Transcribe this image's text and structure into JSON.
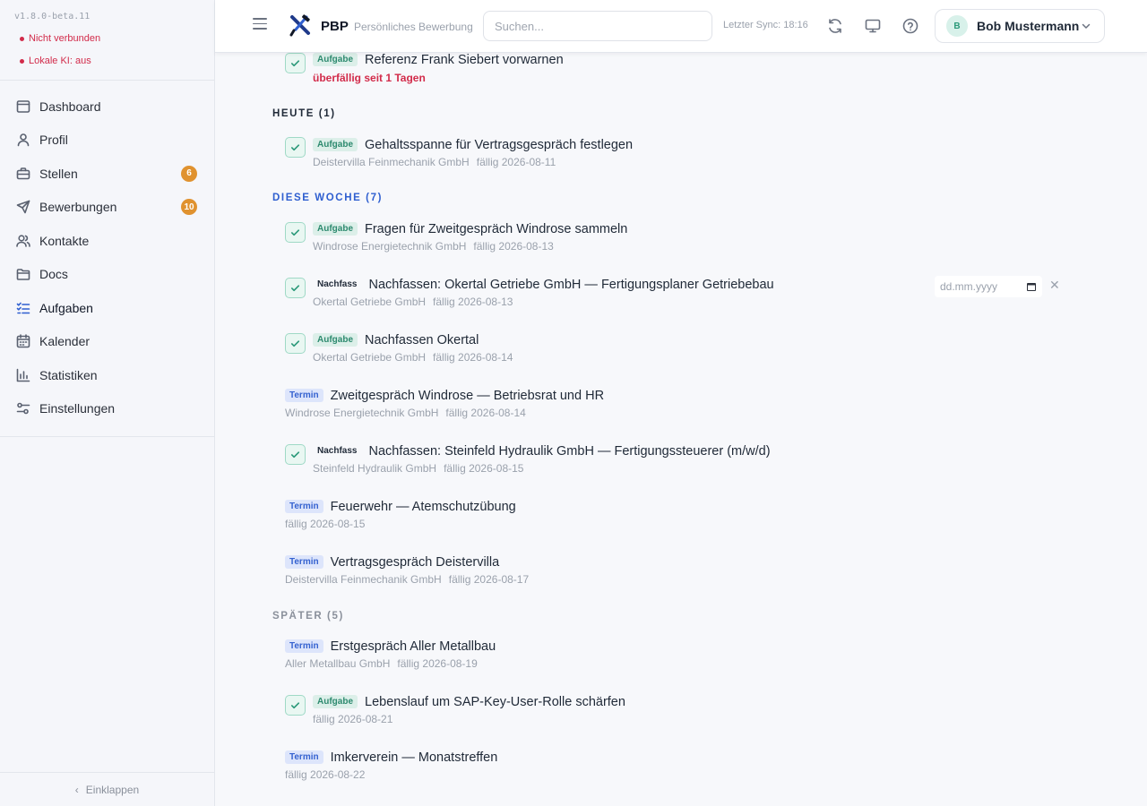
{
  "app": {
    "version": "v1.8.0-beta.11",
    "status": [
      "Nicht verbunden",
      "Lokale KI: aus"
    ],
    "brand": "PBP",
    "brand_subtitle": "Persönliches Bewerbungsportal",
    "search_placeholder": "Suchen...",
    "sync": "Letzter Sync: 18:16",
    "user_initial": "B",
    "user_name": "Bob Mustermann",
    "accent": "#2f5fd0"
  },
  "sidebar": {
    "items": [
      {
        "label": "Dashboard",
        "icon": "dashboard-icon"
      },
      {
        "label": "Profil",
        "icon": "user-icon"
      },
      {
        "label": "Stellen",
        "icon": "briefcase-icon",
        "badge": "6"
      },
      {
        "label": "Bewerbungen",
        "icon": "send-icon",
        "badge": "10"
      },
      {
        "label": "Kontakte",
        "icon": "contacts-icon"
      },
      {
        "label": "Docs",
        "icon": "folder-icon"
      },
      {
        "label": "Aufgaben",
        "icon": "checklist-icon",
        "active": true
      },
      {
        "label": "Kalender",
        "icon": "calendar-icon"
      },
      {
        "label": "Statistiken",
        "icon": "chart-icon"
      },
      {
        "label": "Einstellungen",
        "icon": "settings-icon"
      }
    ],
    "collapse_label": "Einklappen"
  },
  "tasks": {
    "overdue_item": {
      "badge": "Aufgabe",
      "title": "Referenz Frank Siebert vorwarnen",
      "note": "überfällig seit 1 Tagen"
    },
    "sections": [
      {
        "label": "HEUTE (1)",
        "color": "#1f2937"
      },
      {
        "label": "DIESE WOCHE (7)",
        "color": "#2f5fd0"
      },
      {
        "label": "SPÄTER (5)",
        "color": "#8a909b"
      }
    ],
    "items": [
      {
        "badge": "Aufgabe",
        "title": "Gehaltsspanne für Vertragsgespräch festlegen",
        "company": "Deistervilla Feinmechanik GmbH",
        "due": "fällig 2026-08-11"
      },
      {
        "badge": "Aufgabe",
        "title": "Fragen für Zweitgespräch Windrose sammeln",
        "company": "Windrose Energietechnik GmbH",
        "due": "fällig 2026-08-13"
      },
      {
        "badge": "Nachfass",
        "title": "Nachfassen: Okertal Getriebe GmbH — Fertigungsplaner Getriebebau",
        "company": "Okertal Getriebe GmbH",
        "due": "fällig 2026-08-13"
      },
      {
        "badge": "Aufgabe",
        "title": "Nachfassen Okertal",
        "company": "Okertal Getriebe GmbH",
        "due": "fällig 2026-08-14"
      },
      {
        "badge": "Termin",
        "title": "Zweitgespräch Windrose — Betriebsrat und HR",
        "company": "Windrose Energietechnik GmbH",
        "due": "fällig 2026-08-14"
      },
      {
        "badge": "Nachfass",
        "title": "Nachfassen: Steinfeld Hydraulik GmbH — Fertigungssteuerer (m/w/d)",
        "company": "Steinfeld Hydraulik GmbH",
        "due": "fällig 2026-08-15"
      },
      {
        "badge": "Termin",
        "title": "Feuerwehr — Atemschutzübung",
        "company": "",
        "due": "fällig 2026-08-15"
      },
      {
        "badge": "Termin",
        "title": "Vertragsgespräch Deistervilla",
        "company": "Deistervilla Feinmechanik GmbH",
        "due": "fällig 2026-08-17"
      },
      {
        "badge": "Termin",
        "title": "Erstgespräch Aller Metallbau",
        "company": "Aller Metallbau GmbH",
        "due": "fällig 2026-08-19"
      },
      {
        "badge": "Aufgabe",
        "title": "Lebenslauf um SAP-Key-User-Rolle schärfen",
        "company": "",
        "due": "fällig 2026-08-21"
      },
      {
        "badge": "Termin",
        "title": "Imkerverein — Monatstreffen",
        "company": "",
        "due": "fällig 2026-08-22"
      }
    ],
    "date_placeholder": "dd.mm.yyyy"
  }
}
